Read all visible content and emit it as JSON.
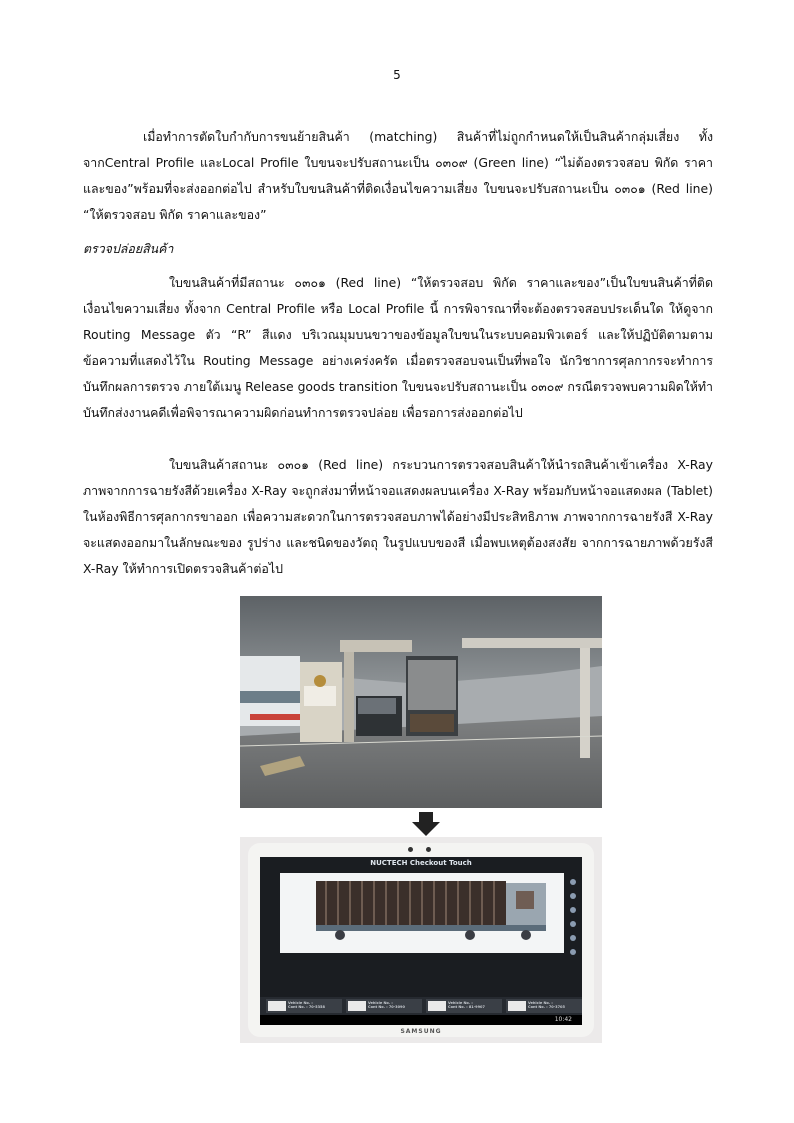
{
  "page": {
    "number": "5"
  },
  "paragraphs": {
    "p1": "เมื่อทำการตัดใบกำกับการขนย้ายสินค้า (matching) สินค้าที่ไม่ถูกกำหนดให้เป็นสินค้ากลุ่มเสี่ยง ทั้งจากCentral Profile และLocal Profile ใบขนจะปรับสถานะเป็น ๐๓๐๙ (Green line) “ไม่ต้องตรวจสอบ พิกัด ราคาและของ”พร้อมที่จะส่งออกต่อไป สำหรับใบขนสินค้าที่ติดเงื่อนไขความเสี่ยง ใบขนจะปรับสถานะเป็น ๐๓๐๑ (Red line) “ให้ตรวจสอบ พิกัด ราคาและของ”",
    "heading": "ตรวจปล่อยสินค้า",
    "p2": "ใบขนสินค้าที่มีสถานะ ๐๓๐๑ (Red line) “ให้ตรวจสอบ พิกัด ราคาและของ”เป็นใบขนสินค้าที่ติดเงื่อนไขความเสี่ยง ทั้งจาก Central Profile หรือ Local Profile นี้ การพิจารณาที่จะต้องตรวจสอบประเด็นใด ให้ดูจาก Routing Message ตัว “R” สีแดง บริเวณมุมบนขวาของข้อมูลใบขนในระบบคอมพิวเตอร์ และให้ปฏิบัติตามตามข้อความที่แสดงไว้ใน Routing Message อย่างเคร่งครัด เมื่อตรวจสอบจนเป็นที่พอใจ นักวิชาการศุลกากรจะทำการบันทึกผลการตรวจ ภายใต้เมนู Release goods transition ใบขนจะปรับสถานะเป็น ๐๓๐๙ กรณีตรวจพบความผิดให้ทำบันทึกส่งงานคดีเพื่อพิจารณาความผิดก่อนทำการตรวจปล่อย เพื่อรอการส่งออกต่อไป",
    "p3": "ใบขนสินค้าสถานะ ๐๓๐๑ (Red line) กระบวนการตรวจสอบสินค้าให้นำรถสินค้าเข้าเครื่อง X-Ray ภาพจากการฉายรังสีด้วยเครื่อง X-Ray จะถูกส่งมาที่หน้าจอแสดงผลบนเครื่อง X-Ray พร้อมกับหน้าจอแสดงผล (Tablet) ในห้องพิธีการศุลกากรขาออก เพื่อความสะดวกในการตรวจสอบภาพได้อย่างมีประสิทธิภาพ ภาพจากการฉายรังสี X-Ray จะแสดงออกมาในลักษณะของ รูปร่าง และชนิดของวัตถุ ในรูปแบบของสี เมื่อพบเหตุต้องสงสัย จากการฉายภาพด้วยรังสี X-Ray ให้ทำการเปิดตรวจสินค้าต่อไป"
  },
  "tablet": {
    "app_title": "NUCTECH Checkout Touch",
    "brand": "SAMSUNG",
    "clock": "10:42",
    "thumbs": [
      {
        "line1": "Vehicle No. :",
        "line2": "Cont No. : 70-5358"
      },
      {
        "line1": "Vehicle No. :",
        "line2": "Cont No. : 70-3090"
      },
      {
        "line1": "Vehicle No. :",
        "line2": "Cont No. : 81-9907"
      },
      {
        "line1": "Vehicle No. :",
        "line2": "Cont No. : 70-3705"
      }
    ]
  }
}
